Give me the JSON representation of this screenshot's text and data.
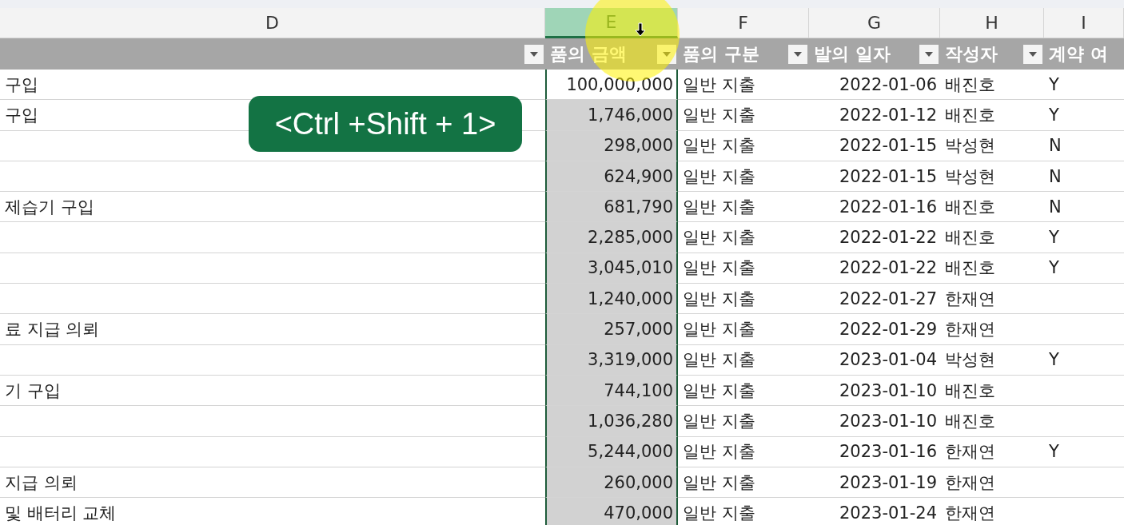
{
  "columns": [
    {
      "letter": "D",
      "selected": false
    },
    {
      "letter": "E",
      "selected": true
    },
    {
      "letter": "F",
      "selected": false
    },
    {
      "letter": "G",
      "selected": false
    },
    {
      "letter": "H",
      "selected": false
    },
    {
      "letter": "I",
      "selected": false
    }
  ],
  "header_cells": [
    {
      "filter": true
    },
    {
      "label": "품의 금액",
      "filter": true
    },
    {
      "label": "품의 구분",
      "filter": true
    },
    {
      "label": "발의 일자",
      "filter": true
    },
    {
      "label": "작성자",
      "filter": true
    },
    {
      "label": "계약 여",
      "filter": false
    }
  ],
  "rows": [
    {
      "active": true,
      "cells": [
        "구입",
        "100,000,000",
        "일반 지출",
        "2022-01-06",
        "배진호",
        "Y"
      ]
    },
    {
      "active": false,
      "cells": [
        "구입",
        "1,746,000",
        "일반 지출",
        "2022-01-12",
        "배진호",
        "Y"
      ]
    },
    {
      "active": false,
      "cells": [
        "",
        "298,000",
        "일반 지출",
        "2022-01-15",
        "박성현",
        "N"
      ]
    },
    {
      "active": false,
      "cells": [
        "",
        "624,900",
        "일반 지출",
        "2022-01-15",
        "박성현",
        "N"
      ]
    },
    {
      "active": false,
      "cells": [
        "제습기 구입",
        "681,790",
        "일반 지출",
        "2022-01-16",
        "배진호",
        "N"
      ]
    },
    {
      "active": false,
      "cells": [
        "",
        "2,285,000",
        "일반 지출",
        "2022-01-22",
        "배진호",
        "Y"
      ]
    },
    {
      "active": false,
      "cells": [
        "",
        "3,045,010",
        "일반 지출",
        "2022-01-22",
        "배진호",
        "Y"
      ]
    },
    {
      "active": false,
      "cells": [
        "",
        "1,240,000",
        "일반 지출",
        "2022-01-27",
        "한재연",
        ""
      ]
    },
    {
      "active": false,
      "cells": [
        "료 지급 의뢰",
        "257,000",
        "일반 지출",
        "2022-01-29",
        "한재연",
        ""
      ]
    },
    {
      "active": false,
      "cells": [
        "",
        "3,319,000",
        "일반 지출",
        "2023-01-04",
        "박성현",
        "Y"
      ]
    },
    {
      "active": false,
      "cells": [
        "기 구입",
        "744,100",
        "일반 지출",
        "2023-01-10",
        "배진호",
        ""
      ]
    },
    {
      "active": false,
      "cells": [
        "",
        "1,036,280",
        "일반 지출",
        "2023-01-10",
        "배진호",
        ""
      ]
    },
    {
      "active": false,
      "cells": [
        "",
        "5,244,000",
        "일반 지출",
        "2023-01-16",
        "한재연",
        "Y"
      ]
    },
    {
      "active": false,
      "cells": [
        "지급 의뢰",
        "260,000",
        "일반 지출",
        "2023-01-19",
        "한재연",
        ""
      ]
    },
    {
      "active": false,
      "cells": [
        "및 배터리 교체",
        "470,000",
        "일반 지출",
        "2023-01-24",
        "한재연",
        ""
      ]
    }
  ],
  "shortcut_badge": "<Ctrl +Shift + 1>"
}
